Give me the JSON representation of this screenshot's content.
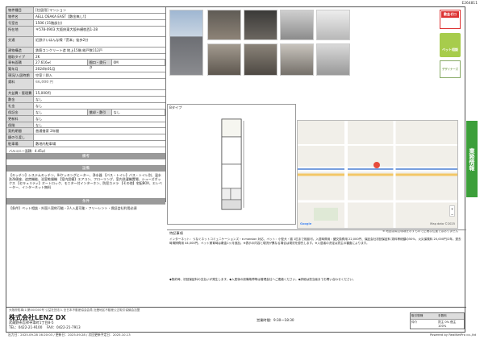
{
  "doc_id": "E264811",
  "spec": {
    "name_label": "物件種目",
    "type_value": "[住居用] マンション",
    "rows": [
      {
        "k": "物件名",
        "v": "AELL OSAKA EAST【敷金無し!】"
      },
      {
        "k": "号室名",
        "v": "1506 (15階部分)"
      },
      {
        "k": "所在地",
        "v": "〒578-0903 大阪府東大阪市横枕西1-28"
      },
      {
        "k": "交通",
        "v": "近鉄けいはんな線「荒本」徒歩2分"
      },
      {
        "k": "建物構造",
        "v": "鉄筋コンクリート造 地上15階 総戸数112戸"
      },
      {
        "k": "間取タイプ",
        "v": "2K"
      },
      {
        "k": "専有面積",
        "v": "27.616㎡",
        "k2": "間口・奥行き",
        "v2": "0M"
      },
      {
        "k": "築年月",
        "v": "2024年01月"
      },
      {
        "k": "現況/入居時期",
        "v": "空室 / 即入"
      }
    ],
    "rent_label": "賃料",
    "rent_value": "66,000 円",
    "rows2": [
      {
        "k": "共益費・管理費",
        "v": "15,000円"
      },
      {
        "k": "敷金",
        "v": "なし",
        "k2": "礼金",
        "v2": "なし"
      },
      {
        "k": "礼金",
        "v": "なし"
      },
      {
        "k": "保証金",
        "v": "なし",
        "k2": "償却・敷引",
        "v2": "なし"
      },
      {
        "k": "更新料",
        "v": "なし"
      },
      {
        "k": "保険",
        "v": "なし"
      },
      {
        "k": "契約期間",
        "v": "普通借家 2年間"
      },
      {
        "k": "鍵の引渡し",
        "v": ""
      },
      {
        "k": "駐車場",
        "v": "敷地内駐車場"
      }
    ],
    "balcony": "バルコニー面積：4.45㎡",
    "remark_header": "備考",
    "equip_header": "設備",
    "equip_text": "【キッチン】システムキッチン、IHクッキングヒーター、浄水器 【バス・トイレ】バス・トイレ別、温水洗浄便座、追焚機能、浴室乾燥機 【室内設備】エアコン、フローリング、室内洗濯機置場、シューズボックス 【セキュリティ】オートロック、モニター付インターホン、防犯カメラ 【その他】宅配BOX、エレベーター、インターネット無料",
    "cond_header": "条件",
    "cond_text": "【条件】ペット相談・外国人契約可能・2人入居可能・フリーレント・保証会社利用必須"
  },
  "stamps": {
    "s1": "敷金ゼロ",
    "s2": "ペット相談",
    "s3": "デザイナーズ"
  },
  "plan_label": "Bタイプ",
  "map": {
    "zoom_plus": "+",
    "zoom_minus": "−",
    "google": "Google",
    "map_data": "Map data ©2025",
    "caption": "※ 地図は周辺環境を示すもので正確な位置ではありません"
  },
  "remarks": {
    "title": "特記事項",
    "text": "インターネット：つなぐネットコミュニケーションズ・e-mansion 対応、ペット：小型犬・猫 1匹まで相談可。入居時費用：鍵交換費用 22,000円、保証会社初回保証料 賃料等総額の50%、火災保険料 20,000円/2年。退去時清掃費用 44,000円。ペット飼育時は敷金1ヶ月追加。※表示の内容と現況が異なる場合は現況を優先します。※入居者の決定は貸主の審査によります。",
    "notes": "◆契約時、初回保証料の支払いが発生します。◆入居後の設備故障等は管理会社へご連絡ください。◆詳細は担当者までお問い合わせください。"
  },
  "company": {
    "license": "大阪府知事(1)第000000号 公益社団法人 全日本不動産協会会員 近畿地区不動産公正取引協議会加盟",
    "name": "株式会社LENZ DX",
    "addr": "武蔵野市吉祥寺本町1丁目8-5",
    "tel": "TEL：0422-21-9100",
    "fax": "FAX：0422-21-7913",
    "hours": "営業時間：9:30～18:30",
    "deal_label": "取引態様",
    "fee_label": "手数料",
    "deal_value": "仲介",
    "fee_value": "貸主 0% 借主 100%"
  },
  "sidetab": "業務情報",
  "footer": {
    "left": "出力日：2025.09.28 16:20:03 / 更新日：2025.09.28 / 次回更新予定日：2025.10.13",
    "right": "Powered by RealNetPro co.,ltd"
  }
}
